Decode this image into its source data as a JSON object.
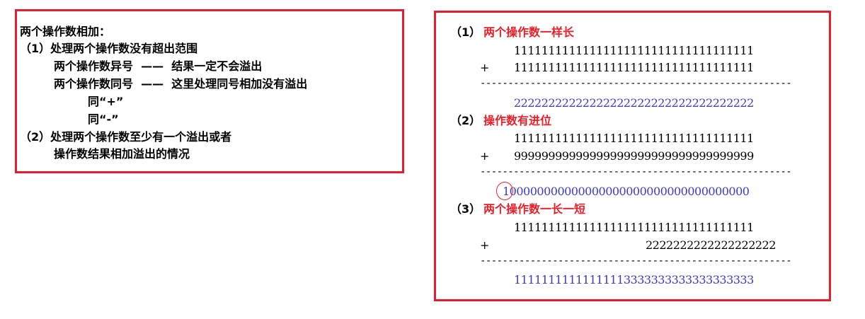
{
  "left": {
    "title": "两个操作数相加：",
    "item1": "（1）处理两个操作数没有超出范围",
    "item1_a": "两个操作数异号  ——  结果一定不会溢出",
    "item1_b": "两个操作数同号  ——  这里处理同号相加没有溢出",
    "item1_b_plus": "同“+”",
    "item1_b_minus": "同“-”",
    "item2": "（2）处理两个操作数至少有一个溢出或者",
    "item2_cont": "操作数结果相加溢出的情况"
  },
  "right": {
    "case1": {
      "label": "（1）",
      "title": "两个操作数一样长",
      "operand1": "11111111111111111111111111111111111",
      "plus": "+",
      "operand2": "11111111111111111111111111111111111",
      "rule": "--------------------------------------------------------",
      "result": "22222222222222222222222222222222222"
    },
    "case2": {
      "label": "（2）",
      "title": "操作数有进位",
      "operand1": "11111111111111111111111111111111111",
      "plus": "+",
      "operand2": "99999999999999999999999999999999999",
      "rule": "--------------------------------------------------------",
      "result": "100000000000000000000000000000000000"
    },
    "case3": {
      "label": "（3）",
      "title": "两个操作数一长一短",
      "operand1": "11111111111111111111111111111111111",
      "plus": "+",
      "operand2": "2222222222222222222",
      "rule": "--------------------------------------------------------",
      "result": "11111111111111113333333333333333333"
    }
  },
  "colors": {
    "border": "#e02030",
    "title_red": "#e8202a",
    "result_blue": "#3b3bc8"
  }
}
